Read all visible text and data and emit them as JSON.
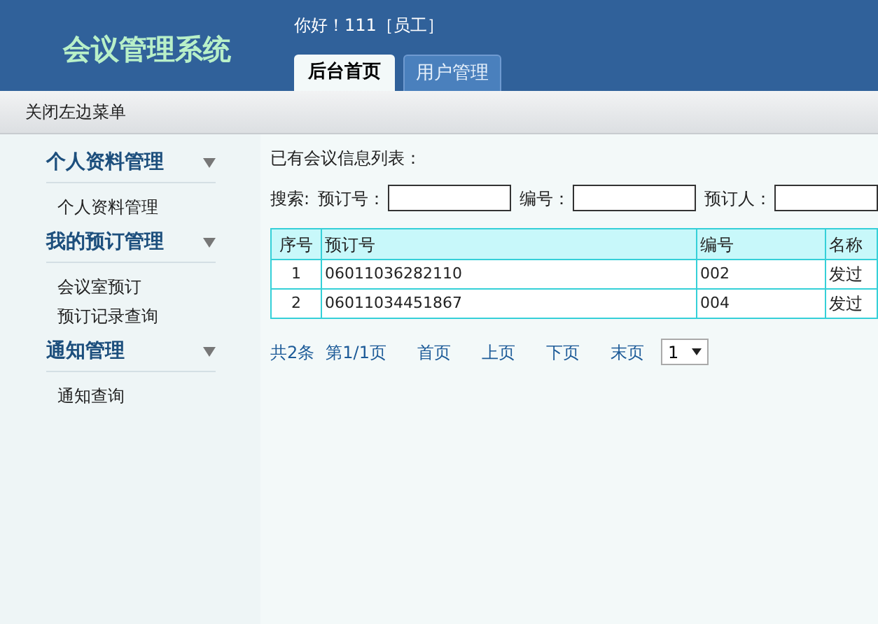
{
  "header": {
    "title": "会议管理系统",
    "greeting": "你好！111［员工］",
    "tabs": [
      {
        "label": "后台首页",
        "selected": true
      },
      {
        "label": "用户管理",
        "selected": false
      }
    ]
  },
  "toolbar": {
    "toggle": "关闭左边菜单"
  },
  "sidebar": {
    "groups": [
      {
        "label": "个人资料管理",
        "items": [
          "个人资料管理"
        ]
      },
      {
        "label": "我的预订管理",
        "items": [
          "会议室预订",
          "预订记录查询"
        ]
      },
      {
        "label": "通知管理",
        "items": [
          "通知查询"
        ]
      }
    ]
  },
  "main": {
    "heading": "已有会议信息列表：",
    "search": {
      "label": "搜索:",
      "fields": [
        {
          "label": "预订号："
        },
        {
          "label": "编号："
        },
        {
          "label": "预订人："
        }
      ]
    },
    "table": {
      "columns": [
        "序号",
        "预订号",
        "编号",
        "名称"
      ],
      "rows": [
        [
          "1",
          "06011036282110",
          "002",
          "发过"
        ],
        [
          "2",
          "06011034451867",
          "004",
          "发过"
        ]
      ]
    },
    "pagination": {
      "total": "共2条",
      "page": "第1/1页",
      "links": [
        "首页",
        "上页",
        "下页",
        "末页"
      ],
      "select": "1"
    }
  }
}
